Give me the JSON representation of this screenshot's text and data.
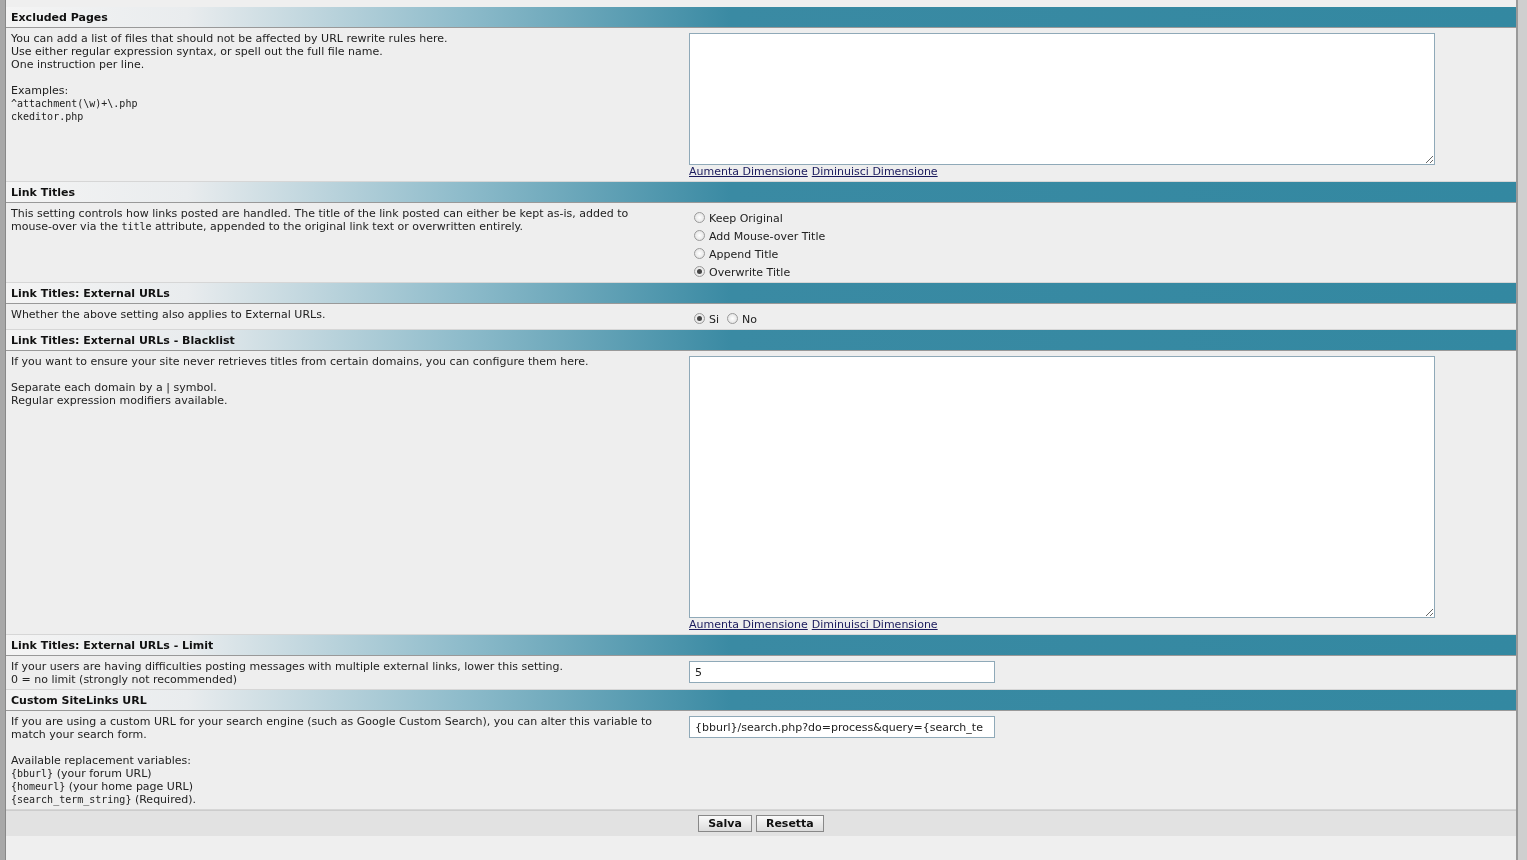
{
  "sections": [
    {
      "title": "Excluded Pages",
      "paragraphs": [
        {
          "lines": [
            [
              {
                "text": "You can add a list of files that should not be affected by URL rewrite rules here.",
                "kind": "text"
              }
            ],
            [
              {
                "text": "Use either regular expression syntax, or spell out the full file name.",
                "kind": "text"
              }
            ],
            [
              {
                "text": "One instruction per line.",
                "kind": "text"
              }
            ]
          ]
        },
        {
          "lines": [
            [
              {
                "text": "Examples:",
                "kind": "text"
              }
            ],
            [
              {
                "text": "^attachment(\\w)+\\.php",
                "kind": "code"
              }
            ],
            [
              {
                "text": "ckeditor.php",
                "kind": "code"
              }
            ]
          ]
        }
      ],
      "control": {
        "kind": "textarea",
        "links": [
          "Aumenta Dimensione",
          "Diminuisci Dimensione"
        ]
      }
    },
    {
      "title": "Link Titles",
      "paragraphs": [
        {
          "lines": [
            [
              {
                "text": "This setting controls how links posted are handled. The title of the link posted can either be kept as-is, added to",
                "kind": "text"
              }
            ],
            [
              {
                "text": "mouse-over via the ",
                "kind": "text"
              },
              {
                "text": "title",
                "kind": "code"
              },
              {
                "text": " attribute, appended to the original link text or overwritten entirely.",
                "kind": "text"
              }
            ]
          ]
        }
      ],
      "control": {
        "kind": "radio_list",
        "options": [
          {
            "label": "Keep Original",
            "selected": false
          },
          {
            "label": "Add Mouse-over Title",
            "selected": false
          },
          {
            "label": "Append Title",
            "selected": false
          },
          {
            "label": "Overwrite Title",
            "selected": true
          }
        ]
      }
    },
    {
      "title": "Link Titles: External URLs",
      "paragraphs": [
        {
          "lines": [
            [
              {
                "text": "Whether the above setting also applies to External URLs.",
                "kind": "text"
              }
            ]
          ]
        }
      ],
      "control": {
        "kind": "radio_row",
        "options": [
          {
            "label": "Si",
            "selected": true
          },
          {
            "label": "No",
            "selected": false
          }
        ]
      }
    },
    {
      "title": "Link Titles: External URLs - Blacklist",
      "paragraphs": [
        {
          "lines": [
            [
              {
                "text": "If you want to ensure your site never retrieves titles from certain domains, you can configure them here.",
                "kind": "text"
              }
            ]
          ]
        },
        {
          "lines": [
            [
              {
                "text": "Separate each domain by a | symbol.",
                "kind": "text"
              }
            ],
            [
              {
                "text": "Regular expression modifiers available.",
                "kind": "text"
              }
            ]
          ]
        }
      ],
      "control": {
        "kind": "tall_textarea",
        "links": [
          "Aumenta Dimensione",
          "Diminuisci Dimensione"
        ]
      }
    },
    {
      "title": "Link Titles: External URLs - Limit",
      "paragraphs": [
        {
          "lines": [
            [
              {
                "text": "If your users are having difficulties posting messages with multiple external links, lower this setting.",
                "kind": "text"
              }
            ],
            [
              {
                "text": "0 = no limit (strongly not recommended)",
                "kind": "text"
              }
            ]
          ]
        }
      ],
      "control": {
        "kind": "input",
        "value": "5"
      }
    },
    {
      "title": "Custom SiteLinks URL",
      "paragraphs": [
        {
          "lines": [
            [
              {
                "text": "If you are using a custom URL for your search engine (such as Google Custom Search), you can alter this variable to",
                "kind": "text"
              }
            ],
            [
              {
                "text": "match your search form.",
                "kind": "text"
              }
            ]
          ]
        },
        {
          "lines": [
            [
              {
                "text": "Available replacement variables:",
                "kind": "text"
              }
            ],
            [
              {
                "text": "{bburl}",
                "kind": "code"
              },
              {
                "text": " (your forum URL)",
                "kind": "text"
              }
            ],
            [
              {
                "text": "{homeurl}",
                "kind": "code"
              },
              {
                "text": " (your home page URL)",
                "kind": "text"
              }
            ],
            [
              {
                "text": "{search_term_string}",
                "kind": "code"
              },
              {
                "text": " (Required).",
                "kind": "text"
              }
            ]
          ]
        }
      ],
      "control": {
        "kind": "input",
        "value": "{bburl}/search.php?do=process&query={search_te"
      }
    }
  ],
  "buttons": [
    "Salva",
    "Resetta"
  ]
}
